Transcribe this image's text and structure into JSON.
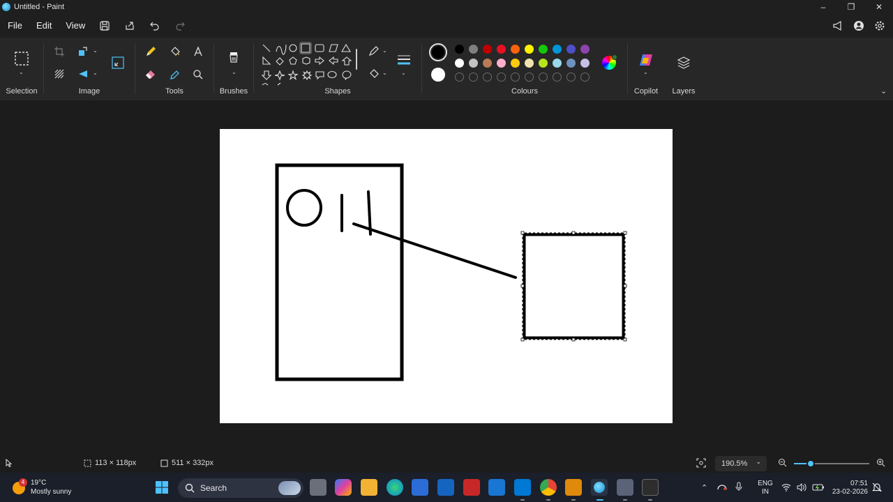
{
  "window": {
    "title": "Untitled - Paint",
    "controls": {
      "minimize": "–",
      "restore": "❐",
      "close": "✕"
    }
  },
  "menu": {
    "file": "File",
    "edit": "Edit",
    "view": "View"
  },
  "ribbon": {
    "groups": {
      "selection": "Selection",
      "image": "Image",
      "tools": "Tools",
      "brushes": "Brushes",
      "shapes": "Shapes",
      "colours": "Colours",
      "copilot": "Copilot",
      "layers": "Layers"
    },
    "primary_color": "#000000",
    "secondary_color": "#ffffff",
    "palette_row1": [
      "#000000",
      "#7f7f7f",
      "#c00000",
      "#e81123",
      "#f7630c",
      "#fff100",
      "#16c60c",
      "#0095d9",
      "#4f4fc8",
      "#8e44ad"
    ],
    "palette_row2": [
      "#ffffff",
      "#c3c3c3",
      "#b97a57",
      "#ffaec9",
      "#ffc90e",
      "#efe4b0",
      "#b5e61d",
      "#99d9ea",
      "#7092be",
      "#c8bfe7"
    ],
    "palette_row3_empty": 10
  },
  "statusbar": {
    "selection_size": "113 × 118px",
    "canvas_size": "511 × 332px",
    "zoom": "190.5%",
    "zoom_fraction": 0.22
  },
  "taskbar": {
    "weather_temp": "19°C",
    "weather_desc": "Mostly sunny",
    "weather_badge": "4",
    "search_placeholder": "Search",
    "language_line1": "ENG",
    "language_line2": "IN",
    "time": "07:51",
    "date": "23-02-2026"
  }
}
